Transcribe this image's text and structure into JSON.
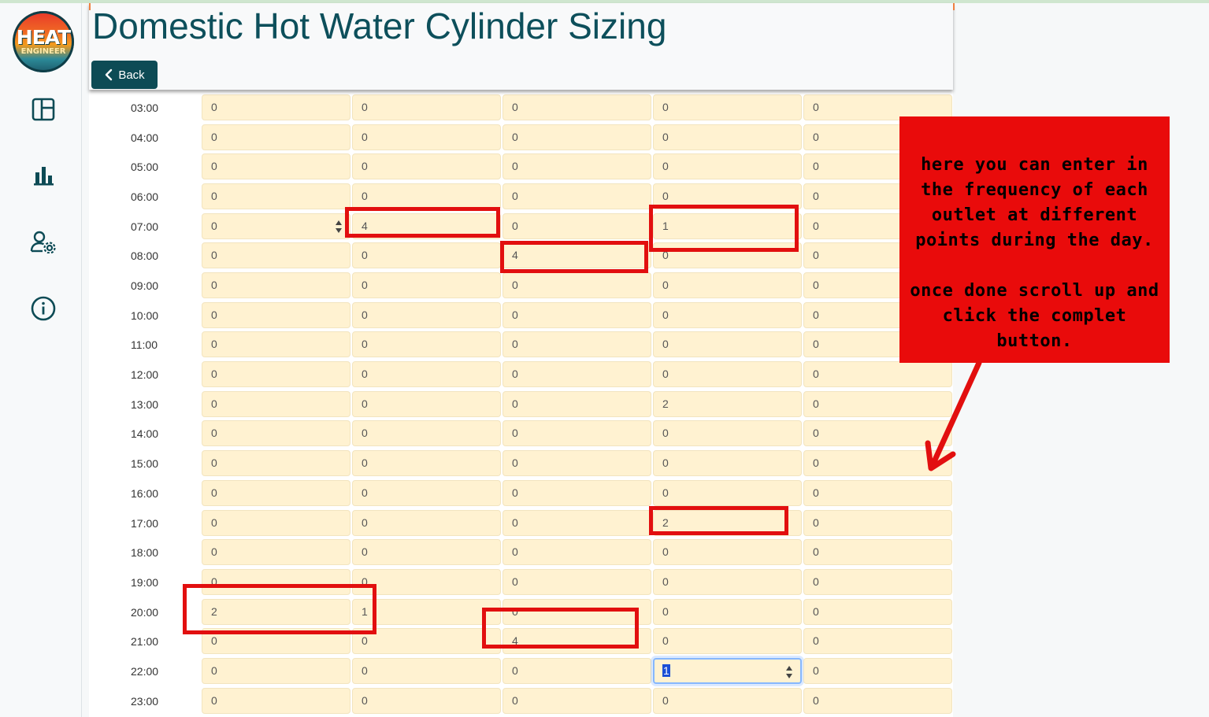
{
  "app": {
    "logo_line1": "HEAT",
    "logo_line2": "ENGINEER"
  },
  "sidebar": {
    "items": [
      {
        "icon": "layout-icon",
        "label": "Dashboard"
      },
      {
        "icon": "bar-chart-icon",
        "label": "Charts"
      },
      {
        "icon": "user-settings-icon",
        "label": "Settings"
      },
      {
        "icon": "info-icon",
        "label": "Info"
      }
    ]
  },
  "header": {
    "title": "Domestic Hot Water Cylinder Sizing",
    "back_label": "Back"
  },
  "table": {
    "rows": [
      {
        "time": "03:00",
        "values": [
          "0",
          "0",
          "0",
          "0",
          "0"
        ]
      },
      {
        "time": "04:00",
        "values": [
          "0",
          "0",
          "0",
          "0",
          "0"
        ]
      },
      {
        "time": "05:00",
        "values": [
          "0",
          "0",
          "0",
          "0",
          "0"
        ]
      },
      {
        "time": "06:00",
        "values": [
          "0",
          "0",
          "0",
          "0",
          "0"
        ]
      },
      {
        "time": "07:00",
        "values": [
          "0",
          "4",
          "0",
          "1",
          "0"
        ]
      },
      {
        "time": "08:00",
        "values": [
          "0",
          "0",
          "4",
          "0",
          "0"
        ]
      },
      {
        "time": "09:00",
        "values": [
          "0",
          "0",
          "0",
          "0",
          "0"
        ]
      },
      {
        "time": "10:00",
        "values": [
          "0",
          "0",
          "0",
          "0",
          "0"
        ]
      },
      {
        "time": "11:00",
        "values": [
          "0",
          "0",
          "0",
          "0",
          "0"
        ]
      },
      {
        "time": "12:00",
        "values": [
          "0",
          "0",
          "0",
          "0",
          "0"
        ]
      },
      {
        "time": "13:00",
        "values": [
          "0",
          "0",
          "0",
          "2",
          "0"
        ]
      },
      {
        "time": "14:00",
        "values": [
          "0",
          "0",
          "0",
          "0",
          "0"
        ]
      },
      {
        "time": "15:00",
        "values": [
          "0",
          "0",
          "0",
          "0",
          "0"
        ]
      },
      {
        "time": "16:00",
        "values": [
          "0",
          "0",
          "0",
          "0",
          "0"
        ]
      },
      {
        "time": "17:00",
        "values": [
          "0",
          "0",
          "0",
          "2",
          "0"
        ]
      },
      {
        "time": "18:00",
        "values": [
          "0",
          "0",
          "0",
          "0",
          "0"
        ]
      },
      {
        "time": "19:00",
        "values": [
          "0",
          "0",
          "0",
          "0",
          "0"
        ]
      },
      {
        "time": "20:00",
        "values": [
          "2",
          "1",
          "0",
          "0",
          "0"
        ]
      },
      {
        "time": "21:00",
        "values": [
          "0",
          "0",
          "4",
          "0",
          "0"
        ]
      },
      {
        "time": "22:00",
        "values": [
          "0",
          "0",
          "0",
          "1",
          "0"
        ]
      },
      {
        "time": "23:00",
        "values": [
          "0",
          "0",
          "0",
          "0",
          "0"
        ]
      }
    ]
  },
  "annotation": {
    "line1": "here you can enter in the frequency of each outlet at different points during the day.",
    "line2": "once done scroll up and click the complet button."
  },
  "colors": {
    "brand": "#0d4b55",
    "cell_bg": "#fff2d1",
    "annotation_red": "#e90b0b"
  }
}
